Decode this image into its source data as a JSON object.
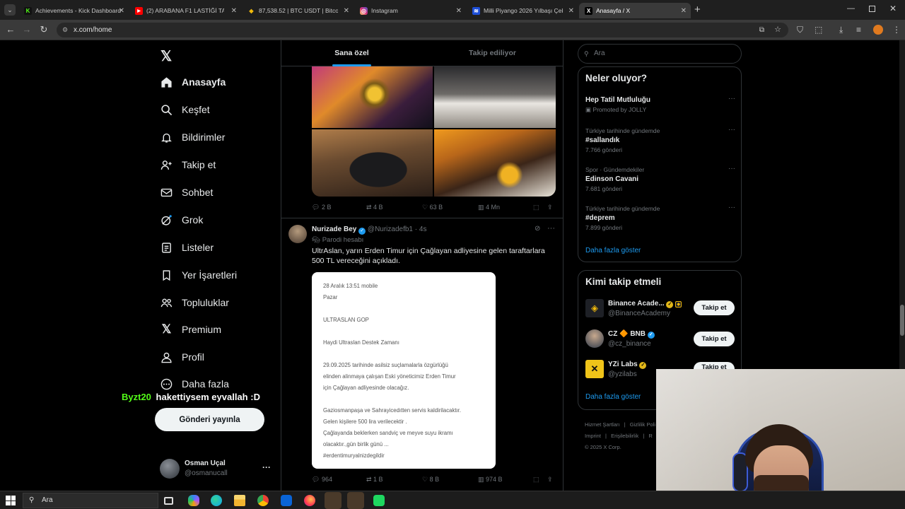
{
  "browser": {
    "tabs": [
      {
        "title": "Achievements - Kick Dashboard",
        "fav": "K",
        "color": "#53fc18"
      },
      {
        "title": "(2) ARABANA F1 LASTİĞİ TAKAR",
        "fav": "▶",
        "color": "#ff0000"
      },
      {
        "title": "87,538.52 | BTC USDT | Bitcoin t",
        "fav": "◆",
        "color": "#f0b90b"
      },
      {
        "title": "Instagram",
        "fav": "◎",
        "color": "#d62976"
      },
      {
        "title": "Milli Piyango 2026 Yılbaşı Çekil",
        "fav": "≋",
        "color": "#1d4ed8"
      },
      {
        "title": "Anasayfa / X",
        "fav": "X",
        "color": "#000000"
      }
    ],
    "url": "x.com/home"
  },
  "nav": {
    "items": [
      "Anasayfa",
      "Keşfet",
      "Bildirimler",
      "Takip et",
      "Sohbet",
      "Grok",
      "Listeler",
      "Yer İşaretleri",
      "Topluluklar",
      "Premium",
      "Profil",
      "Daha fazla"
    ],
    "post_button": "Gönderi yayınla",
    "user_name": "Osman Uçal",
    "user_handle": "@osmanucall"
  },
  "overlay": {
    "user": "Byzt20",
    "message": "hakettiysem eyvallah :D"
  },
  "feed": {
    "tabs": [
      "Sana özel",
      "Takip ediliyor"
    ],
    "post1_stats": {
      "replies": "2 B",
      "reposts": "4 B",
      "likes": "63 B",
      "views": "4 Mn"
    },
    "post2": {
      "name": "Nurizade Bey",
      "handle": "@Nurizadefb1",
      "time": "· 4s",
      "label": "Parodi hesabı",
      "text": "UltrAslan, yarın Erden Timur için Çağlayan adliyesine gelen taraftarlara 500 TL vereceğini açıkladı.",
      "note_lines": [
        "28 Aralık 13:51 mobile",
        "Pazar",
        "",
        "ULTRASLAN GOP",
        "",
        "Haydi Ultraslan Destek Zamanı",
        "",
        "29.09.2025 tarihinde asilsiz suçlamalarla özgürlüğü",
        "elinden alinmaya çalışan Eski yöneticimiz Erden Timur",
        "için Çağlayan adliyesinde olacağız.",
        "",
        "Gaziosmanpaşa ve Sahrayicedıtten servis kaldirilacaktır.",
        "Gelen kişilere 500 lira verilecektir .",
        "Çağlayanda beklerken sandviç ve meyve suyu ikramı",
        "olacaktır.,gün birlik günü ...",
        "#erdentimuryalnizdegildir"
      ],
      "stats": {
        "replies": "964",
        "reposts": "1 B",
        "likes": "8 B",
        "views": "974 B"
      }
    }
  },
  "sidebar": {
    "search_placeholder": "Ara",
    "trends_title": "Neler oluyor?",
    "trends": [
      {
        "context": "",
        "name": "Hep Tatil Mutluluğu",
        "meta": "Promoted by JOLLY"
      },
      {
        "context": "Türkiye tarihinde gündemde",
        "name": "#sallandık",
        "meta": "7.766 gönderi"
      },
      {
        "context": "Spor · Gündemdekiler",
        "name": "Edinson Cavani",
        "meta": "7.681 gönderi"
      },
      {
        "context": "Türkiye tarihinde gündemde",
        "name": "#deprem",
        "meta": "7.899 gönderi"
      }
    ],
    "show_more": "Daha fazla göster",
    "who_title": "Kimi takip etmeli",
    "who": [
      {
        "name": "Binance Acade...",
        "handle": "@BinanceAcademy",
        "button": "Takip et"
      },
      {
        "name": "CZ 🔶 BNB",
        "handle": "@cz_binance",
        "button": "Takip et"
      },
      {
        "name": "YZi Labs",
        "handle": "@yzilabs",
        "button": "Takip et"
      }
    ],
    "who_more": "Daha fazla göster",
    "footer": [
      "Hizmet Şartları",
      "Gizlilik Poli",
      "Imprint",
      "Erişilebilirlik",
      "R"
    ],
    "copyright": "© 2025 X Corp."
  },
  "taskbar": {
    "search": "Ara"
  },
  "colors": {
    "accent": "#1d9bf0",
    "verified": "#1d9bf0",
    "gold_verified": "#e2b719",
    "overlay_user": "#53fc18"
  }
}
